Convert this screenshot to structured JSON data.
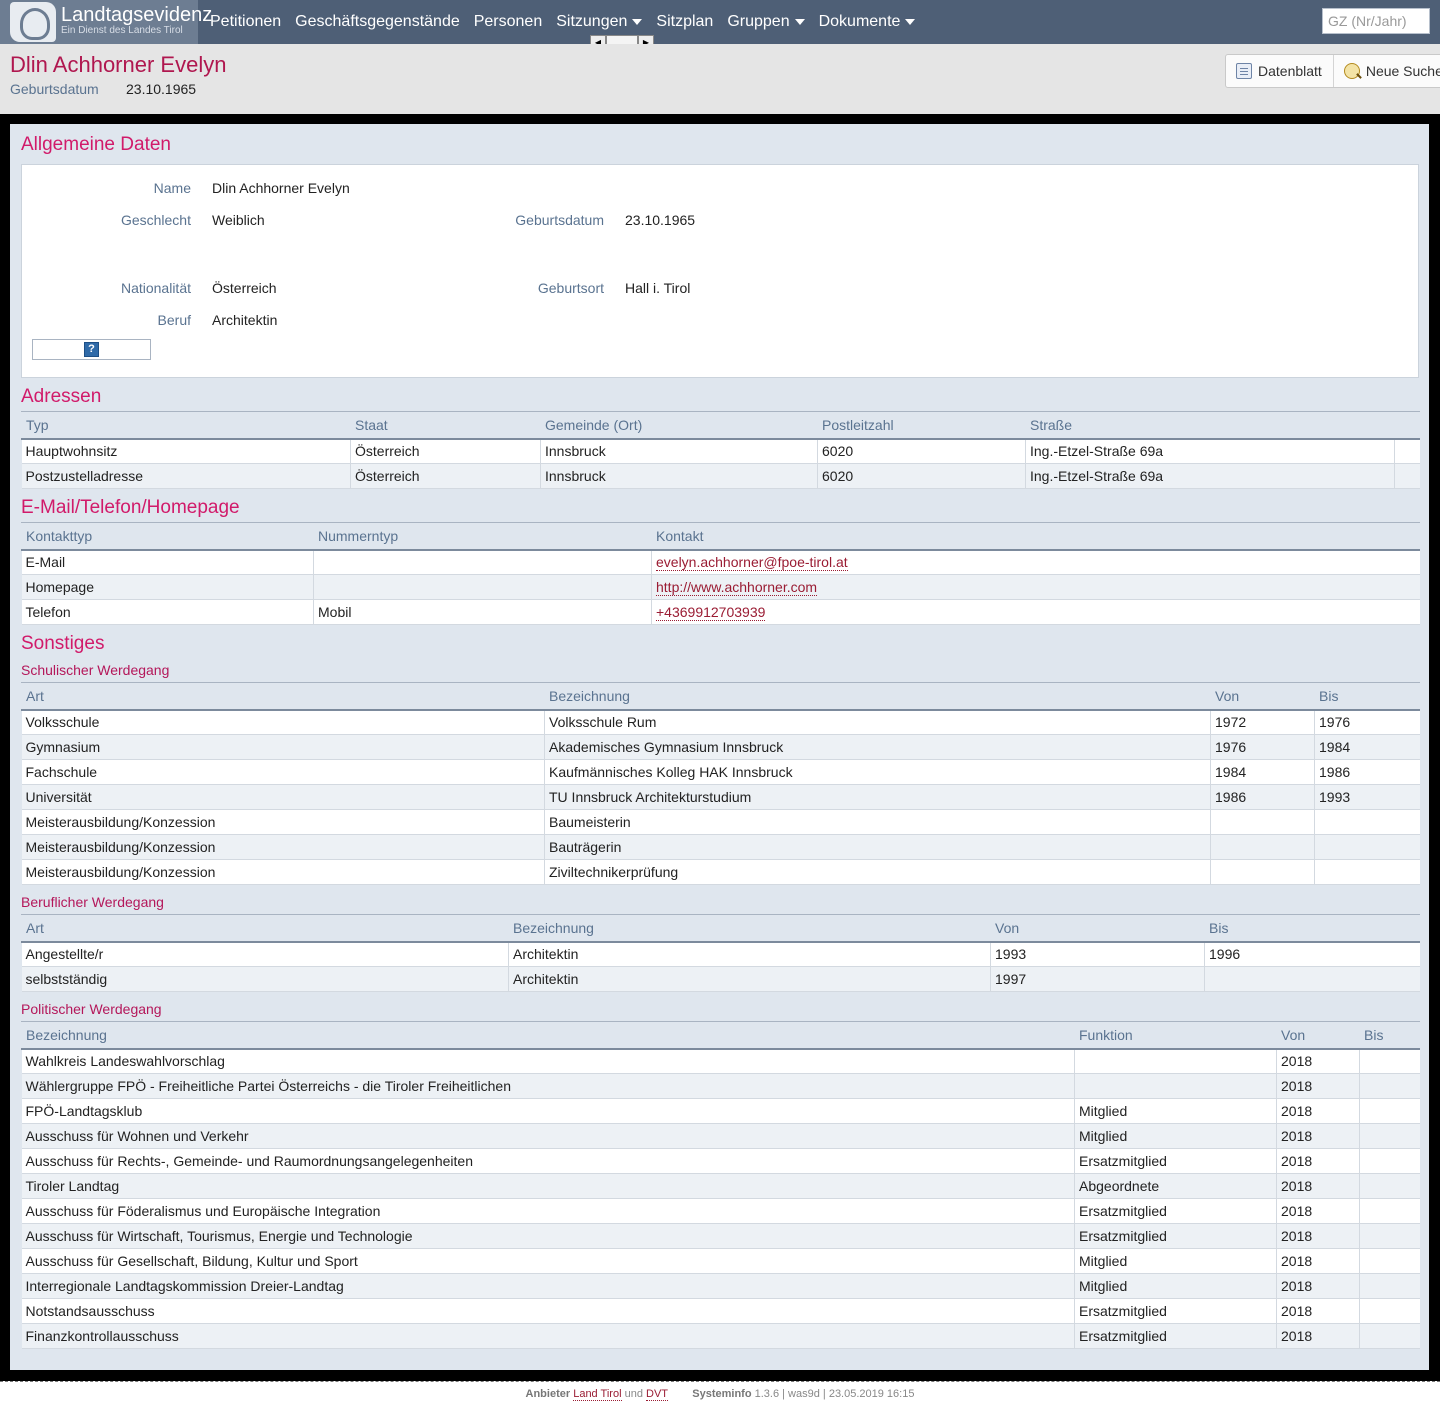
{
  "brand": {
    "title": "Landtagsevidenz",
    "subtitle": "Ein Dienst des Landes Tirol"
  },
  "nav": {
    "items": [
      {
        "label": "Petitionen",
        "dropdown": false
      },
      {
        "label": "Geschäftsgegenstände",
        "dropdown": false
      },
      {
        "label": "Personen",
        "dropdown": false
      },
      {
        "label": "Sitzungen",
        "dropdown": true
      },
      {
        "label": "Sitzplan",
        "dropdown": false
      },
      {
        "label": "Gruppen",
        "dropdown": true
      },
      {
        "label": "Dokumente",
        "dropdown": true
      }
    ],
    "search_placeholder": "GZ (Nr/Jahr)"
  },
  "header": {
    "title": "Dlin Achhorner Evelyn",
    "birth_label": "Geburtsdatum",
    "birth_value": "23.10.1965",
    "buttons": {
      "datenblatt": "Datenblatt",
      "neue_suche": "Neue Suche"
    }
  },
  "general": {
    "title": "Allgemeine Daten",
    "name_label": "Name",
    "name_value": "Dlin Achhorner Evelyn",
    "gender_label": "Geschlecht",
    "gender_value": "Weiblich",
    "birthdate_label": "Geburtsdatum",
    "birthdate_value": "23.10.1965",
    "nationality_label": "Nationalität",
    "nationality_value": "Österreich",
    "birthplace_label": "Geburtsort",
    "birthplace_value": "Hall i. Tirol",
    "job_label": "Beruf",
    "job_value": "Architektin"
  },
  "addresses": {
    "title": "Adressen",
    "columns": [
      "Typ",
      "Staat",
      "Gemeinde (Ort)",
      "Postleitzahl",
      "Straße"
    ],
    "rows": [
      [
        "Hauptwohnsitz",
        "Österreich",
        "Innsbruck",
        "6020",
        "Ing.-Etzel-Straße 69a"
      ],
      [
        "Postzustelladresse",
        "Österreich",
        "Innsbruck",
        "6020",
        "Ing.-Etzel-Straße 69a"
      ]
    ]
  },
  "contacts": {
    "title": "E-Mail/Telefon/Homepage",
    "columns": [
      "Kontakttyp",
      "Nummerntyp",
      "Kontakt"
    ],
    "rows": [
      [
        "E-Mail",
        "",
        "evelyn.achhorner@fpoe-tirol.at"
      ],
      [
        "Homepage",
        "",
        "http://www.achhorner.com"
      ],
      [
        "Telefon",
        "Mobil",
        "+4369912703939"
      ]
    ]
  },
  "misc": {
    "title": "Sonstiges",
    "school": {
      "title": "Schulischer Werdegang",
      "columns": [
        "Art",
        "Bezeichnung",
        "Von",
        "Bis"
      ],
      "rows": [
        [
          "Volksschule",
          "Volksschule Rum",
          "1972",
          "1976"
        ],
        [
          "Gymnasium",
          "Akademisches Gymnasium Innsbruck",
          "1976",
          "1984"
        ],
        [
          "Fachschule",
          "Kaufmännisches Kolleg HAK Innsbruck",
          "1984",
          "1986"
        ],
        [
          "Universität",
          "TU Innsbruck Architekturstudium",
          "1986",
          "1993"
        ],
        [
          "Meisterausbildung/Konzession",
          "Baumeisterin",
          "",
          ""
        ],
        [
          "Meisterausbildung/Konzession",
          "Bauträgerin",
          "",
          ""
        ],
        [
          "Meisterausbildung/Konzession",
          "Ziviltechnikerprüfung",
          "",
          ""
        ]
      ]
    },
    "career": {
      "title": "Beruflicher Werdegang",
      "columns": [
        "Art",
        "Bezeichnung",
        "Von",
        "Bis"
      ],
      "rows": [
        [
          "Angestellte/r",
          "Architektin",
          "1993",
          "1996"
        ],
        [
          "selbstständig",
          "Architektin",
          "1997",
          ""
        ]
      ]
    },
    "political": {
      "title": "Politischer Werdegang",
      "columns": [
        "Bezeichnung",
        "Funktion",
        "Von",
        "Bis"
      ],
      "rows": [
        [
          "Wahlkreis Landeswahlvorschlag",
          "",
          "2018",
          ""
        ],
        [
          "Wählergruppe FPÖ - Freiheitliche Partei Österreichs - die Tiroler Freiheitlichen",
          "",
          "2018",
          ""
        ],
        [
          "FPÖ-Landtagsklub",
          "Mitglied",
          "2018",
          ""
        ],
        [
          "Ausschuss für Wohnen und Verkehr",
          "Mitglied",
          "2018",
          ""
        ],
        [
          "Ausschuss für Rechts-, Gemeinde- und Raumordnungsangelegenheiten",
          "Ersatzmitglied",
          "2018",
          ""
        ],
        [
          "Tiroler Landtag",
          "Abgeordnete",
          "2018",
          ""
        ],
        [
          "Ausschuss für Föderalismus und Europäische Integration",
          "Ersatzmitglied",
          "2018",
          ""
        ],
        [
          "Ausschuss für Wirtschaft, Tourismus, Energie und Technologie",
          "Ersatzmitglied",
          "2018",
          ""
        ],
        [
          "Ausschuss für Gesellschaft, Bildung, Kultur und Sport",
          "Mitglied",
          "2018",
          ""
        ],
        [
          "Interregionale Landtagskommission Dreier-Landtag",
          "Mitglied",
          "2018",
          ""
        ],
        [
          "Notstandsausschuss",
          "Ersatzmitglied",
          "2018",
          ""
        ],
        [
          "Finanzkontrollausschuss",
          "Ersatzmitglied",
          "2018",
          ""
        ]
      ]
    }
  },
  "footer": {
    "provider_label": "Anbieter",
    "provider_link1": "Land Tirol",
    "and": "und",
    "provider_link2": "DVT",
    "sysinfo_label": "Systeminfo",
    "sysinfo_value": "1.3.6 | was9d | 23.05.2019 16:15"
  }
}
